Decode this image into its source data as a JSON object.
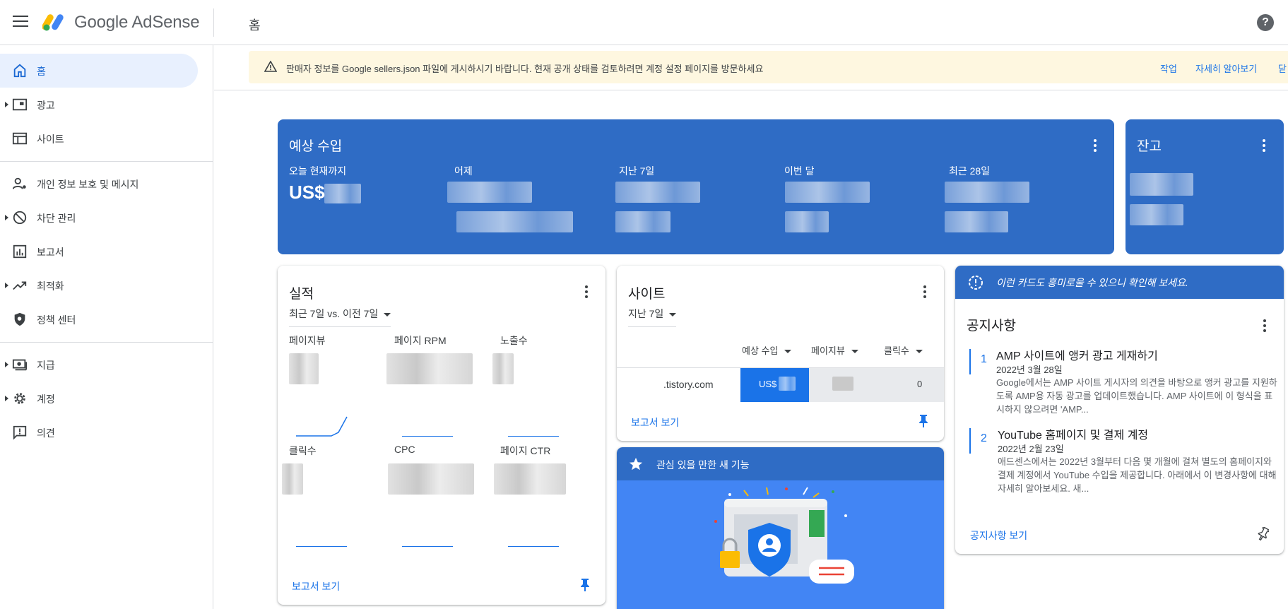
{
  "header": {
    "brand_google": "Google",
    "brand_product": "AdSense",
    "page_title": "홈",
    "help": "?"
  },
  "sidebar": {
    "items": [
      {
        "label": "홈"
      },
      {
        "label": "광고"
      },
      {
        "label": "사이트"
      },
      {
        "label": "개인 정보 보호 및 메시지"
      },
      {
        "label": "차단 관리"
      },
      {
        "label": "보고서"
      },
      {
        "label": "최적화"
      },
      {
        "label": "정책 센터"
      },
      {
        "label": "지급"
      },
      {
        "label": "계정"
      },
      {
        "label": "의견"
      }
    ]
  },
  "alert": {
    "message": "판매자 정보를 Google sellers.json 파일에 게시하시기 바랍니다. 현재 공개 상태를 검토하려면 계정 설정 페이지를 방문하세요",
    "action1": "작업",
    "action2": "자세히 알아보기",
    "action3": "닫"
  },
  "earnings": {
    "title": "예상 수입",
    "cols": [
      "오늘 현재까지",
      "어제",
      "지난 7일",
      "이번 달",
      "최근 28일"
    ],
    "today_prefix": "US$"
  },
  "balance": {
    "title": "잔고"
  },
  "performance": {
    "title": "실적",
    "range": "최근 7일 vs. 이전 7일",
    "metrics": [
      "페이지뷰",
      "페이지 RPM",
      "노출수",
      "클릭수",
      "CPC",
      "페이지 CTR"
    ],
    "report_link": "보고서 보기"
  },
  "sites": {
    "title": "사이트",
    "range": "지난 7일",
    "headers": [
      "예상 수입",
      "페이지뷰",
      "클릭수"
    ],
    "row": {
      "site": ".tistory.com",
      "earnings_prefix": "US$",
      "clicks": "0"
    },
    "report_link": "보고서 보기"
  },
  "new_features": {
    "title": "관심 있을 만한 새 기능"
  },
  "announcements": {
    "banner": "이런 카드도 흥미로울 수 있으니 확인해 보세요.",
    "title": "공지사항",
    "items": [
      {
        "num": "1",
        "title": "AMP 사이트에 앵커 광고 게재하기",
        "date": "2022년 3월 28일",
        "body": "Google에서는 AMP 사이트 게시자의 의견을 바탕으로 앵커 광고를 지원하도록 AMP용 자동 광고를 업데이트했습니다. AMP 사이트에 이 형식을 표시하지 않으려면 'AMP..."
      },
      {
        "num": "2",
        "title": "YouTube 홈페이지 및 결제 계정",
        "date": "2022년 2월 23일",
        "body": "애드센스에서는 2022년 3월부터 다음 몇 개월에 걸쳐 별도의 홈페이지와 결제 계정에서 YouTube 수입을 제공합니다. 아래에서 이 변경사항에 대해 자세히 알아보세요. 새..."
      }
    ],
    "link": "공지사항 보기"
  },
  "colors": {
    "primary_blue": "#1a73e8",
    "card_blue": "#2f6cc5",
    "alert_bg": "#fef7e0"
  }
}
